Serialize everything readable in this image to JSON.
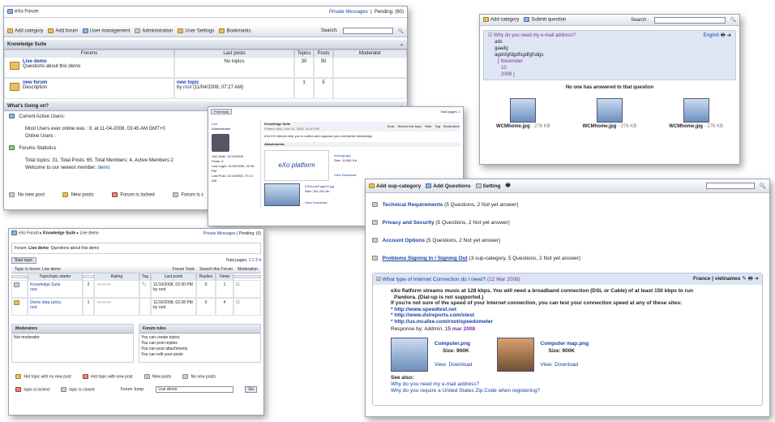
{
  "w1": {
    "title": "eXo Forum",
    "private": "Private Messages",
    "pending": "Pending: (60)",
    "toolbar": [
      "Add category",
      "Add forum",
      "User management",
      "Administration",
      "User Settings",
      "Bookmarks"
    ],
    "search_label": "Search:",
    "category": "Knowledge Suite",
    "cols": [
      "Forums",
      "Last posts",
      "Topics",
      "Posts",
      "Moderator"
    ],
    "rows": [
      {
        "name": "Live demo",
        "desc": "Questions about this demo",
        "last": "No topics",
        "topics": "30",
        "posts": "30"
      },
      {
        "name": "new forum",
        "desc": "Description",
        "last_title": "new topic",
        "last_by": "by",
        "last_user": "root",
        "last_date": "(11/04/2008, 07:27 AM)",
        "topics": "1",
        "posts": "5"
      }
    ],
    "going_on": "What's Going on?",
    "active_title": "Current Active Users:",
    "most_users": "Most Users ever online was : 0, at 11-04-2008, 03:45 AM GMT+0",
    "online": "Online Users :",
    "stats_title": "Forums Statistics",
    "stats": "Total topics: 31, Total Posts: 65, Total Members: 4, Active Members:2",
    "newest": "Welcome to our newest member:",
    "newest_user": "demo",
    "legend": [
      "No new post",
      "New posts",
      "Forum is locked",
      "Forum is c"
    ]
  },
  "w2": {
    "toolbar": [
      "Add category",
      "Submit question"
    ],
    "search": "Search :",
    "question": "Why do you need my e-mail address?",
    "lang": "English",
    "lines": [
      "ads",
      "gaadg",
      "agdsfgfdgdfsgdfgfsdgs"
    ],
    "date_lines": [
      "[ November",
      "10",
      "2008 ]"
    ],
    "no_answer": "No one has answered to that question",
    "thumbs": [
      {
        "name": "WCMhome.jpg",
        "size": "- 276 KB"
      },
      {
        "name": "WCMhome.jpg",
        "size": "- 276 KB"
      },
      {
        "name": "WCMhome.jpg",
        "size": "- 276 KB"
      }
    ]
  },
  "w3": {
    "post_reply": "Post reply",
    "total_pages": "Total pages:",
    "page": "1",
    "user": "root",
    "role": "Administrator",
    "info": [
      "Join Date: 11/10/2008",
      "Posts: 4",
      "Last Login: 11/10/2008, 02:30 PM",
      "Last Post: 11/10/2008, 07:13 AM"
    ],
    "post_title": "Knowledge Suite",
    "posted": "Posted: Mon, Nov 10, 2008, 02:30 PM",
    "tools": [
      "Tools",
      "Search this topic",
      "Rate",
      "Tag",
      "Moderation"
    ],
    "body": "eXo KS intends help you to collect and organize your enterprise knowledge.",
    "attach": "Attachments:",
    "logo": "eXo platform",
    "files": [
      {
        "name": "exologo.jpg",
        "size": "Size: 11.861 Kb"
      },
      {
        "name": "KSHomePage02.jpg",
        "size": "Size: 161.224 Kb"
      }
    ],
    "view": "View",
    "download": "Download"
  },
  "w4": {
    "crumbs": [
      "eXo Forum",
      "Knowledge Suite",
      "Live demo"
    ],
    "private": "Private Messages",
    "pending": "Pending: (0)",
    "forum_label": "Forum:",
    "forum_name": "Live demo",
    "forum_desc": "Questions about this demo",
    "start": "Start topic",
    "total_pages": "Total pages:",
    "pages": [
      "1",
      "2",
      "3",
      "4"
    ],
    "topic_in": "Topic in forum: Live demo",
    "forum_tools": "Forum Tools",
    "search_forum": "Search this Forum",
    "moderation": "Moderation",
    "cols": [
      "Topic/topic starter",
      "Rating",
      "Tag",
      "Last posts",
      "Replies",
      "Views"
    ],
    "rows": [
      {
        "title": "Knowledge Suite",
        "by": "root",
        "replies_n": "2",
        "date": "11/10/2008, 02:30 PM",
        "last_by": "by root",
        "replies": "0",
        "views": "1"
      },
      {
        "title": "Demo data policy",
        "by": "root",
        "replies_n": "1",
        "date": "11/10/2008, 02:28 PM",
        "last_by": "by root",
        "replies": "0",
        "views": "4"
      }
    ],
    "moderators": "Moderators",
    "not_mod": "Not moderator",
    "rules": "Forum rules",
    "rule_lines": [
      "You can create topics",
      "You can post replies",
      "You can post attachments",
      "You can edit your posts"
    ],
    "legend": [
      "Hot topic with no new post",
      "Hot topic with new post",
      "New posts",
      "No new posts",
      "topic is locked",
      "topic is closed"
    ],
    "jump": "Forum Jump:",
    "jump_val": "Live demo",
    "go": "Go"
  },
  "w5": {
    "toolbar": [
      "Add sup-category",
      "Add Questions",
      "Setting"
    ],
    "cats": [
      {
        "name": "Technical Requirements",
        "info": "(5 Questions, 2 Not yet answer)"
      },
      {
        "name": "Privacy and Security",
        "info": "(5 Questions, 2 Not yet answer)"
      },
      {
        "name": "Account Options",
        "info": "(5 Questions, 2 Not yet answer)"
      },
      {
        "name": "Problems Signing In / Signing Out",
        "info": "(3 sup-category, 5 Questions, 2 Not yet answer)"
      }
    ],
    "q": "What type of Internet Connection do I need?",
    "q_date": "(12 Mar 2008)",
    "lang": "France | vietnames",
    "ans1": "eXo flatform streams music at 128 kbps. You will need a broadband connection (DSL or Cable) of at least 150 kbps to run",
    "ans2": "Pandora. (Dial-up is not supported.)",
    "ans3": "If you're not sure of the speed of your Internet connection, you can test your connection speed at any of these sites:",
    "links": [
      "http://www.speedtest.net",
      "http://www.dslreports.com/stest",
      "http://us.mcafee.com/root/speedometer"
    ],
    "resp_by": "Response by: Addmin,",
    "resp_date": "15 mar 2008",
    "files": [
      {
        "name": "Computer.png",
        "size": "Size: 900K"
      },
      {
        "name": "Computer map.png",
        "size": "Size: 900K"
      }
    ],
    "view": "View",
    "download": "Download",
    "see": "See also:",
    "see_links": [
      "Why do you need my e-mail address?",
      "Why do you require a United States Zip Code when registering?"
    ]
  }
}
